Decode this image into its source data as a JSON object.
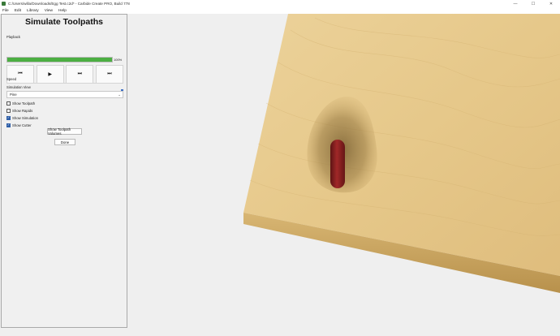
{
  "window": {
    "title": "C:/Users/willa/Downloads/Egg Test.c2d* - Carbide Create PRO, Build 778",
    "controls": {
      "minimize": "—",
      "maximize": "☐",
      "close": "✕"
    }
  },
  "menu": [
    {
      "label": "File"
    },
    {
      "label": "Edit"
    },
    {
      "label": "Library"
    },
    {
      "label": "View"
    },
    {
      "label": "Help"
    }
  ],
  "panel": {
    "title": "Simulate Toolpaths",
    "playback_label": "Playback",
    "progress": {
      "value": 100,
      "label": "100%",
      "color": "#4caf42"
    },
    "buttons": {
      "rewind": "⏮",
      "play": "▶",
      "step": "⏭",
      "end": "⏭"
    },
    "speed_label": "Speed",
    "speed_value": 1.0,
    "simulation_view_label": "Simulation View",
    "simulation_view_selected": "Pine",
    "checkboxes": [
      {
        "label": "Show Toolpath",
        "checked": false
      },
      {
        "label": "Show Rapids",
        "checked": false
      },
      {
        "label": "Show Simulation",
        "checked": true
      },
      {
        "label": "Show Cutter",
        "checked": true
      }
    ],
    "show_volumes_label": "Show Toolpath Volumes",
    "done_label": "Done"
  },
  "viewport": {
    "material_color": "#e9cd94",
    "edge_color": "#d9b775",
    "pocket_shape": "egg-shaped pocket",
    "cutter_color": "#8f2020"
  }
}
